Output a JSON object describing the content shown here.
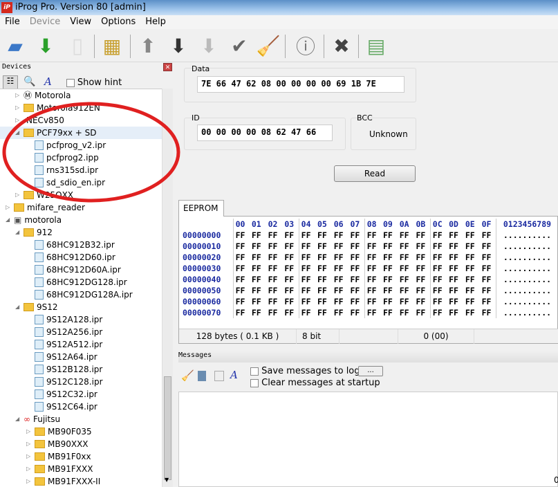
{
  "window": {
    "title": "iProg Pro. Version 80 [admin]",
    "logo": "iP"
  },
  "menu": [
    "File",
    "Device",
    "View",
    "Options",
    "Help"
  ],
  "toolbar": [
    "open-folder-icon",
    "save-download-icon",
    "new-file-icon",
    "chip-icon",
    "arrow-up-icon",
    "arrow-down-icon",
    "arrow-down-light-icon",
    "check-icon",
    "broom-icon",
    "info-icon",
    "close-x-icon",
    "calculator-icon"
  ],
  "devices": {
    "title": "Devices",
    "show_hint": "Show hint",
    "tree": [
      {
        "label": "Motorola",
        "level": 2,
        "icon": "motorola-icon"
      },
      {
        "label": "Motorola912EN",
        "level": 2,
        "icon": "folder"
      },
      {
        "label": "NECv850",
        "level": 2,
        "icon": "none"
      },
      {
        "label": "PCF79xx + SD",
        "level": 2,
        "icon": "folder",
        "expanded": true,
        "selected": true
      },
      {
        "label": "pcfprog_v2.ipr",
        "level": 3,
        "icon": "file"
      },
      {
        "label": "pcfprog2.ipp",
        "level": 3,
        "icon": "file"
      },
      {
        "label": "rns315sd.ipr",
        "level": 3,
        "icon": "file"
      },
      {
        "label": "sd_sdio_en.ipr",
        "level": 3,
        "icon": "file"
      },
      {
        "label": "W25QXX",
        "level": 2,
        "icon": "folder"
      },
      {
        "label": "mifare_reader",
        "level": 1,
        "icon": "folder"
      },
      {
        "label": "motorola",
        "level": 1,
        "icon": "chip",
        "expanded": true
      },
      {
        "label": "912",
        "level": 2,
        "icon": "folder",
        "expanded": true
      },
      {
        "label": "68HC912B32.ipr",
        "level": 3,
        "icon": "file"
      },
      {
        "label": "68HC912D60.ipr",
        "level": 3,
        "icon": "file"
      },
      {
        "label": "68HC912D60A.ipr",
        "level": 3,
        "icon": "file"
      },
      {
        "label": "68HC912DG128.ipr",
        "level": 3,
        "icon": "file"
      },
      {
        "label": "68HC912DG128A.ipr",
        "level": 3,
        "icon": "file"
      },
      {
        "label": "9S12",
        "level": 2,
        "icon": "folder",
        "expanded": true
      },
      {
        "label": "9S12A128.ipr",
        "level": 3,
        "icon": "file"
      },
      {
        "label": "9S12A256.ipr",
        "level": 3,
        "icon": "file"
      },
      {
        "label": "9S12A512.ipr",
        "level": 3,
        "icon": "file"
      },
      {
        "label": "9S12A64.ipr",
        "level": 3,
        "icon": "file"
      },
      {
        "label": "9S12B128.ipr",
        "level": 3,
        "icon": "file"
      },
      {
        "label": "9S12C128.ipr",
        "level": 3,
        "icon": "file"
      },
      {
        "label": "9S12C32.ipr",
        "level": 3,
        "icon": "file"
      },
      {
        "label": "9S12C64.ipr",
        "level": 3,
        "icon": "file"
      },
      {
        "label": "Fujitsu",
        "level": 2,
        "icon": "fujitsu-icon",
        "expanded": true
      },
      {
        "label": "MB90F035",
        "level": 3,
        "icon": "folder"
      },
      {
        "label": "MB90XXX",
        "level": 3,
        "icon": "folder"
      },
      {
        "label": "MB91F0xx",
        "level": 3,
        "icon": "folder"
      },
      {
        "label": "MB91FXXX",
        "level": 3,
        "icon": "folder"
      },
      {
        "label": "MB91FXXX-II",
        "level": 3,
        "icon": "folder"
      }
    ]
  },
  "data": {
    "label": "Data",
    "value": "7E 66 47 62 08 00 00 00 00 69 1B 7E"
  },
  "id": {
    "label": "ID",
    "value": "00 00 00 00 08 62 47 66"
  },
  "bcc": {
    "label": "BCC",
    "value": "Unknown"
  },
  "read_label": "Read",
  "tab": "EEPROM",
  "hex": {
    "columns": [
      "00",
      "01",
      "02",
      "03",
      "04",
      "05",
      "06",
      "07",
      "08",
      "09",
      "0A",
      "0B",
      "0C",
      "0D",
      "0E",
      "0F"
    ],
    "ascii_header": "0123456789",
    "rows": [
      {
        "addr": "00000000",
        "bytes": "FF",
        "ascii": ".........."
      },
      {
        "addr": "00000010",
        "bytes": "FF",
        "ascii": ".........."
      },
      {
        "addr": "00000020",
        "bytes": "FF",
        "ascii": ".........."
      },
      {
        "addr": "00000030",
        "bytes": "FF",
        "ascii": ".........."
      },
      {
        "addr": "00000040",
        "bytes": "FF",
        "ascii": ".........."
      },
      {
        "addr": "00000050",
        "bytes": "FF",
        "ascii": ".........."
      },
      {
        "addr": "00000060",
        "bytes": "FF",
        "ascii": ".........."
      },
      {
        "addr": "00000070",
        "bytes": "FF",
        "ascii": ".........."
      }
    ]
  },
  "status": {
    "size": "128 bytes ( 0.1 KB )",
    "bits": "8 bit",
    "value": "0 (00)"
  },
  "messages": {
    "title": "Messages",
    "save_log": "Save messages to log fi",
    "browse": "...",
    "clear_startup": "Clear messages at startup",
    "corner": "0"
  }
}
